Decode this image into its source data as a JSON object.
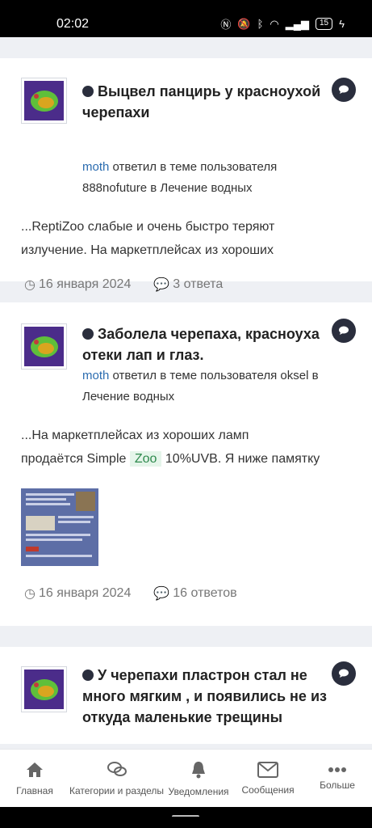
{
  "status_bar": {
    "time": "02:02",
    "battery": "15"
  },
  "posts": [
    {
      "title": "Выцвел панцирь у красноухой черепахи",
      "title_line1": "Выцвел панцирь у красноухой",
      "title_line2": "черепахи",
      "user": "moth",
      "meta_line1": "ответил в теме пользователя",
      "meta_line2": "888nofuture в Лечение водных",
      "snippet_line1": "...ReptiZoo слабые и очень быстро теряют",
      "snippet_line2": "излучение. На маркетплейсах из хороших",
      "date": "16 января 2024",
      "replies": "3 ответа"
    },
    {
      "title_line1": "Заболела черепаха, красноуха",
      "title_line2": "отеки лап и глаз.",
      "user": "moth",
      "meta_line1": "ответил в теме пользователя oksel в",
      "meta_line2": "Лечение водных",
      "snippet_line1": "...На маркетплейсах из хороших ламп",
      "snippet_pre": "продаётся Simple",
      "snippet_hl": "Zoo",
      "snippet_post": "10%UVB. Я ниже памятку",
      "date": "16 января 2024",
      "replies": "16 ответов"
    },
    {
      "title_line1": "У черепахи пластрон стал не",
      "title_line2": "много мягким , и появились не из",
      "title_line3": "откуда маленькие трещины"
    }
  ],
  "nav": [
    {
      "label": "Главная",
      "icon": "home-icon"
    },
    {
      "label": "Категории и разделы",
      "icon": "chat-icon"
    },
    {
      "label": "Уведомления",
      "icon": "bell-icon"
    },
    {
      "label": "Сообщения",
      "icon": "envelope-icon"
    },
    {
      "label": "Больше",
      "icon": "more-icon"
    }
  ]
}
